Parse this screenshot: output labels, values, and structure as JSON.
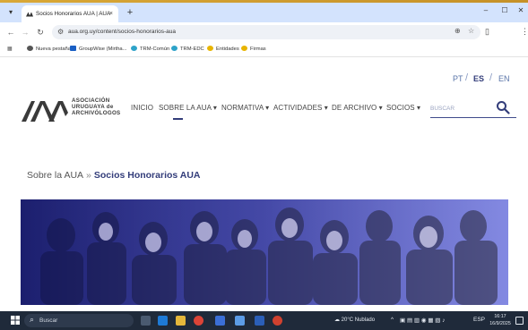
{
  "browser": {
    "tab_title": "Socios Honorarios AUA | AUA",
    "tab_close": "×",
    "new_tab": "+",
    "url": "aua.org.uy/content/socios-honorarios-aua",
    "window_controls": [
      "–",
      "☐",
      "✕"
    ]
  },
  "bookmarks": [
    {
      "label": "Nueva pestaña",
      "icon": "globe-icon",
      "color": "#555555"
    },
    {
      "label": "GroupWise (Mirtha...",
      "icon": "mail-icon",
      "color": "#1a5fc4"
    },
    {
      "label": "TRM-Común",
      "icon": "trm-icon",
      "color": "#2ea3c9"
    },
    {
      "label": "TRM-EDC",
      "icon": "trm-icon",
      "color": "#2ea3c9"
    },
    {
      "label": "Entidades",
      "icon": "star-icon",
      "color": "#e8b400"
    },
    {
      "label": "Firmas",
      "icon": "star-icon",
      "color": "#e8b400"
    }
  ],
  "site": {
    "languages": [
      "PT",
      "ES",
      "EN"
    ],
    "language_sep": "/",
    "active_language": "ES",
    "logo_lines": [
      "ASOCIACIÓN",
      "URUGUAYA de",
      "ARCHIVÓLOGOS"
    ],
    "nav": [
      {
        "label": "INICIO"
      },
      {
        "label": "SOBRE LA AUA ▾"
      },
      {
        "label": "NORMATIVA ▾"
      },
      {
        "label": "ACTIVIDADES ▾"
      },
      {
        "label": "DE ARCHIVO ▾"
      },
      {
        "label": "SOCIOS ▾"
      }
    ],
    "search_placeholder": "BUSCAR",
    "breadcrumb_parent": "Sobre la AUA",
    "breadcrumb_sep": "»",
    "breadcrumb_current": "Socios Honorarios AUA",
    "accent_color": "#333d7a",
    "banner_tint": "#3a3fb0"
  },
  "taskbar": {
    "search_text": "Buscar",
    "weather": "20°C  Nublado",
    "lang": "ESP",
    "time": "16:17",
    "date": "16/9/2025"
  }
}
